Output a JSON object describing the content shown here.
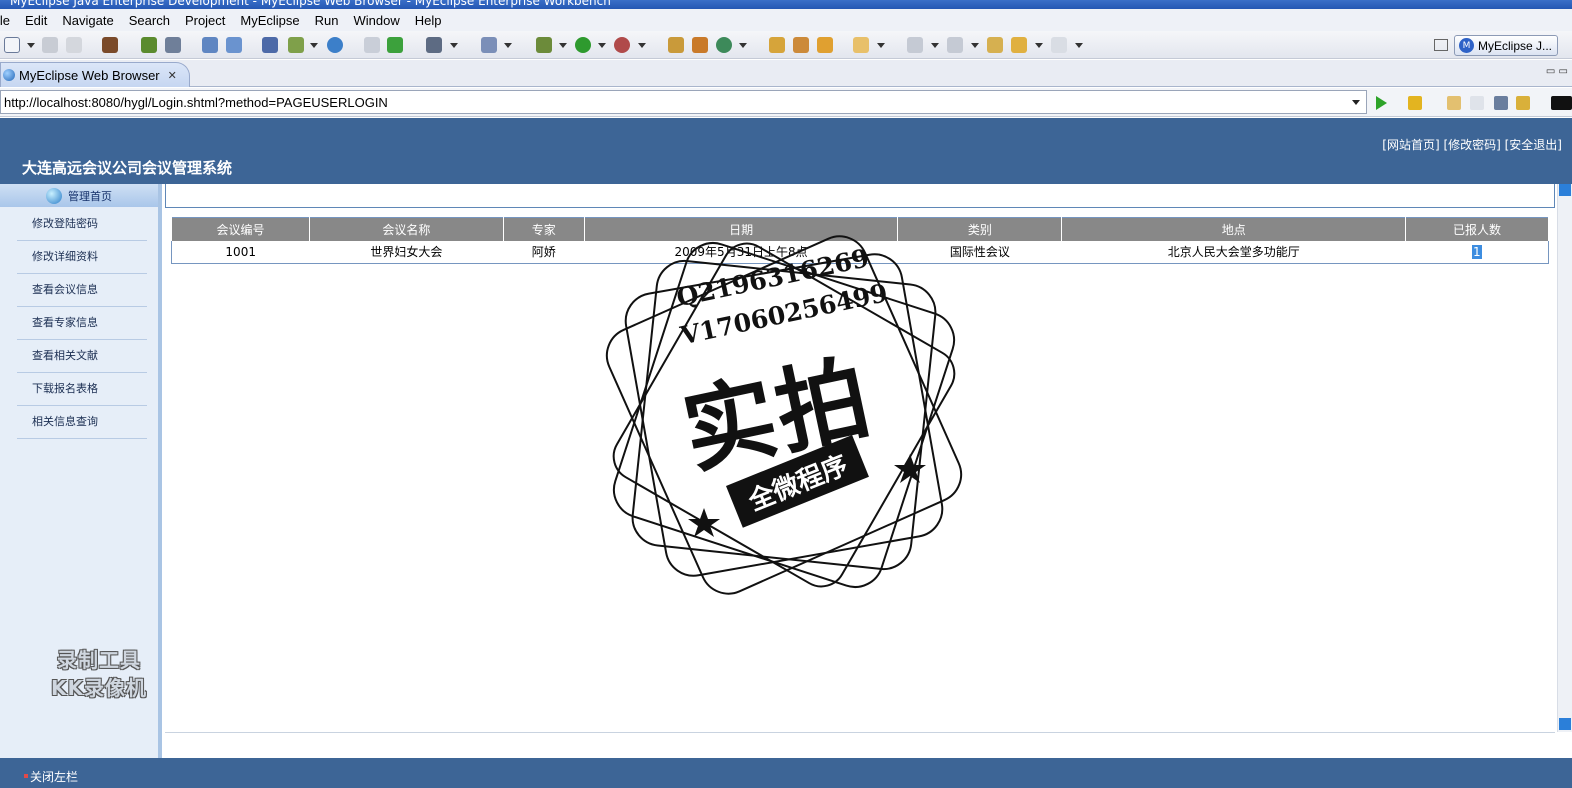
{
  "window": {
    "title": "MyEclipse Java Enterprise Development - MyEclipse Web Browser - MyEclipse Enterprise Workbench"
  },
  "menu": [
    "ile",
    "Edit",
    "Navigate",
    "Search",
    "Project",
    "MyEclipse",
    "Run",
    "Window",
    "Help"
  ],
  "perspective": {
    "label": "MyEclipse J..."
  },
  "editor_tab": {
    "label": "MyEclipse Web Browser",
    "close": "✕"
  },
  "address": {
    "url": "http://localhost:8080/hygl/Login.shtml?method=PAGEUSERLOGIN"
  },
  "page": {
    "site_title": "大连高远会议公司会议管理系统",
    "top_links": "[网站首页] [修改密码] [安全退出]",
    "sidebar_header": "管理首页",
    "sidebar_items": [
      "修改登陆密码",
      "修改详细资料",
      "查看会议信息",
      "查看专家信息",
      "查看相关文献",
      "下载报名表格",
      "相关信息查询"
    ],
    "table": {
      "headers": [
        "会议编号",
        "会议名称",
        "专家",
        "日期",
        "类别",
        "地点",
        "已报人数"
      ],
      "rows": [
        [
          "1001",
          "世界妇女大会",
          "阿娇",
          "2009年5月31日上午8点",
          "国际性会议",
          "北京人民大会堂多功能厅",
          "1"
        ]
      ]
    },
    "footer_link": "关闭左栏"
  },
  "overlays": {
    "recorder_line1": "录制工具",
    "recorder_line2": "KK录像机",
    "stamp_q": "Q2196316269",
    "stamp_v": "V17060256499",
    "stamp_main": "实拍",
    "stamp_banner": "全微程序"
  },
  "colors": {
    "header_blue": "#3d6596",
    "table_header_gray": "#888888",
    "sidebar_bg": "#e6eef8"
  }
}
